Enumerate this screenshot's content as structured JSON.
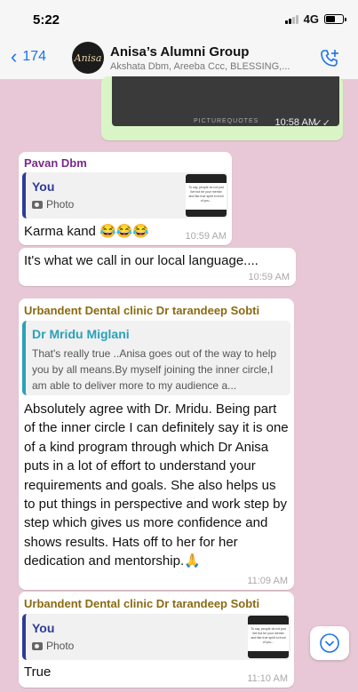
{
  "status": {
    "time": "5:22",
    "network": "4G"
  },
  "header": {
    "back_count": "174",
    "avatar_text": "Anisa",
    "title": "Anisa’s Alumni Group",
    "subtitle": "Akshata Dbm, Areeba Ccc, BLESSING,..."
  },
  "messages": {
    "image_msg": {
      "watermark": "PICTUREQUOTES",
      "time": "10:58 AM"
    },
    "pavan": {
      "sender": "Pavan Dbm",
      "sender_color": "#7b2a8a",
      "quote_name": "You",
      "quote_type": "Photo",
      "text": "Karma kand 😂😂😂",
      "time": "10:59 AM"
    },
    "local": {
      "text": "It's what we call in our local language....",
      "time": "10:59 AM"
    },
    "urb1": {
      "sender": "Urbandent Dental clinic Dr tarandeep Sobti",
      "sender_color": "#8a6a12",
      "quote_name": "Dr Mridu Miglani",
      "quote_color": "#2aa1b8",
      "quote_text": "That's really true ..Anisa goes out of the way to help you by all means.By myself joining the inner circle,I am able to deliver more to my audience a...",
      "text": "Absolutely agree with Dr. Mridu. Being part of the inner circle I can definitely say it is one of a kind program through which Dr Anisa puts in a lot of effort to understand your requirements and goals. She also helps us to put things in perspective and work step by step which gives us more confidence and shows results. Hats off to her for her dedication and mentorship.🙏",
      "time": "11:09 AM"
    },
    "urb2": {
      "sender": "Urbandent Dental clinic Dr tarandeep Sobti",
      "quote_name": "You",
      "quote_type": "Photo",
      "text": "True",
      "time": "11:10 AM"
    },
    "thumb_text": "To say, people do not just live but be your mentor and like true spirit in front of you..."
  }
}
